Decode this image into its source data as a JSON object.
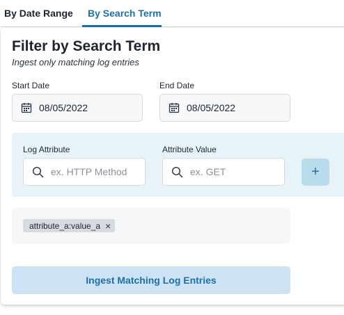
{
  "tabs": [
    {
      "label": "By Date Range",
      "active": false
    },
    {
      "label": "By Search Term",
      "active": true
    }
  ],
  "header": {
    "title": "Filter by Search Term",
    "subtitle": "Ingest only matching log entries"
  },
  "dates": {
    "start_label": "Start Date",
    "start_value": "08/05/2022",
    "end_label": "End Date",
    "end_value": "08/05/2022"
  },
  "attribute": {
    "key_label": "Log Attribute",
    "key_placeholder": "ex. HTTP Method",
    "value_label": "Attribute Value",
    "value_placeholder": "ex. GET",
    "add_label": "+"
  },
  "tags": [
    {
      "text": "attribute_a:value_a",
      "remove": "×"
    }
  ],
  "submit_label": "Ingest Matching Log Entries",
  "colors": {
    "accent": "#1d6fa8",
    "panel": "#e8f3f8",
    "button_bg": "#cde3f3"
  }
}
